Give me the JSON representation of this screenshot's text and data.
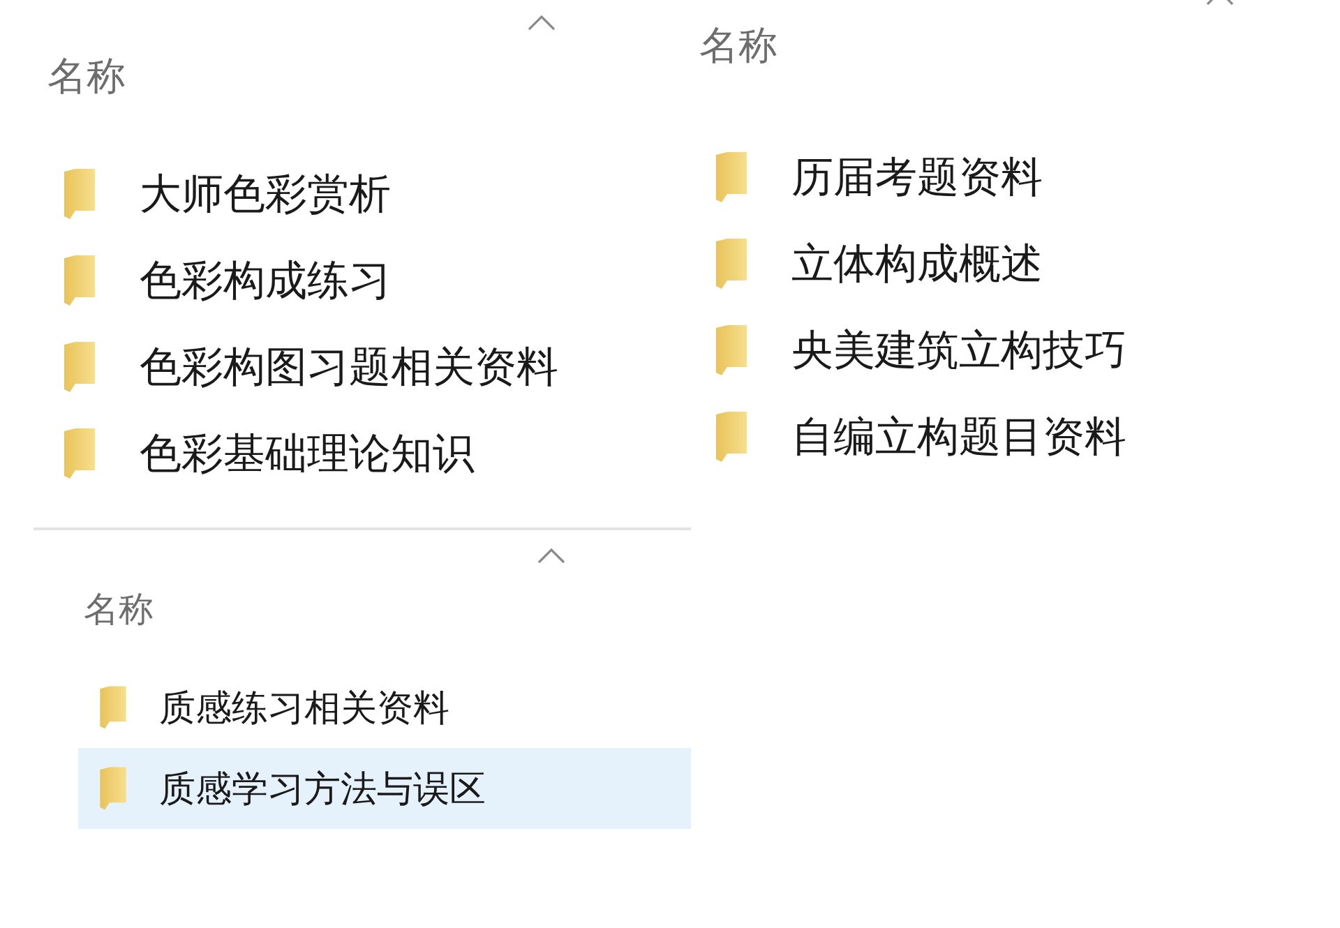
{
  "panes": [
    {
      "header": {
        "label": "名称",
        "sorted": true
      },
      "items": [
        {
          "name": "大师色彩赏析",
          "selected": false
        },
        {
          "name": "色彩构成练习",
          "selected": false
        },
        {
          "name": "色彩构图习题相关资料",
          "selected": false
        },
        {
          "name": "色彩基础理论知识",
          "selected": false
        }
      ]
    },
    {
      "header": {
        "label": "名称",
        "sorted": true
      },
      "items": [
        {
          "name": "历届考题资料",
          "selected": false
        },
        {
          "name": "立体构成概述",
          "selected": false
        },
        {
          "name": "央美建筑立构技巧",
          "selected": false
        },
        {
          "name": "自编立构题目资料",
          "selected": false
        }
      ]
    },
    {
      "header": {
        "label": "名称",
        "sorted": true
      },
      "items": [
        {
          "name": "质感练习相关资料",
          "selected": false
        },
        {
          "name": "质感学习方法与误区",
          "selected": true
        }
      ]
    }
  ]
}
